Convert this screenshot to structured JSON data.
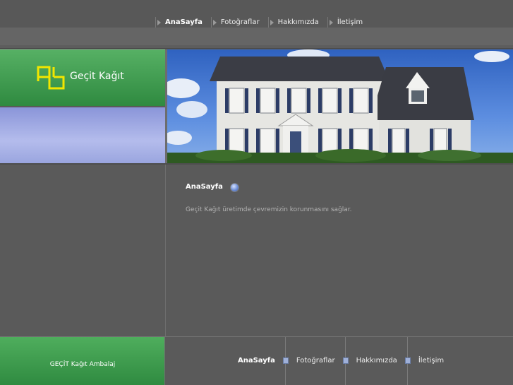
{
  "nav": {
    "items": [
      {
        "label": "AnaSayfa",
        "active": true
      },
      {
        "label": "Fotoğraflar",
        "active": false
      },
      {
        "label": "Hakkımızda",
        "active": false
      },
      {
        "label": "İletişim",
        "active": false
      }
    ]
  },
  "brand": {
    "name": "Geçit Kağıt",
    "logo_icon": "gb-logo-icon",
    "logo_color": "#f2e600"
  },
  "hero": {
    "image_icon": "house-photo"
  },
  "content": {
    "title": "AnaSayfa",
    "title_icon": "blue-orb-icon",
    "description": "Geçit Kağıt üretimde çevremizin korunmasını sağlar."
  },
  "footer": {
    "company": "GEÇİT Kağıt Ambalaj",
    "nav": [
      {
        "label": "AnaSayfa",
        "active": true
      },
      {
        "label": "Fotoğraflar",
        "active": false
      },
      {
        "label": "Hakkımızda",
        "active": false
      },
      {
        "label": "İletişim",
        "active": false
      }
    ]
  },
  "colors": {
    "accent_green": "#3a9a4c",
    "background": "#5a5a5a"
  }
}
